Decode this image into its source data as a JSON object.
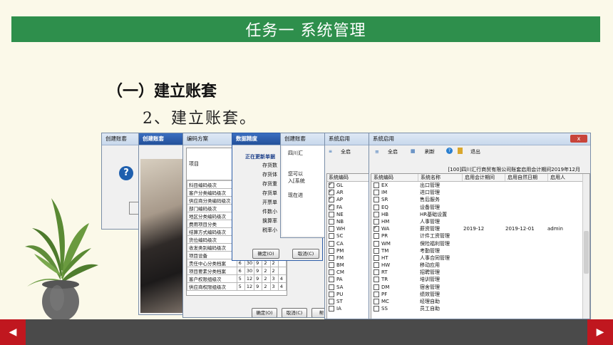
{
  "slide": {
    "title": "任务一 系统管理",
    "heading": "（一）建立账套",
    "subheading": "2、建立账套。"
  },
  "windows": {
    "create1_title": "创建账套",
    "create2_title": "创建账套",
    "code_scheme": {
      "title": "编码方案",
      "header": "项目",
      "rows": [
        {
          "label": "科目编码级次"
        },
        {
          "label": "客户分类编码级次"
        },
        {
          "label": "供应商分类编码级次"
        },
        {
          "label": "部门编码级次"
        },
        {
          "label": "地区分类编码级次"
        },
        {
          "label": "费用项目分类"
        },
        {
          "label": "结算方式编码级次"
        },
        {
          "label": "货位编码级次"
        },
        {
          "label": "收发类别编码级次"
        },
        {
          "label": "项目设备"
        },
        {
          "label": "责任中心分类档案",
          "v": [
            "6",
            "30",
            "9",
            "2",
            "2"
          ]
        },
        {
          "label": "项目要素分类档案",
          "v": [
            "6",
            "30",
            "9",
            "2",
            "2"
          ]
        },
        {
          "label": "客户权限组级次",
          "v": [
            "5",
            "12",
            "9",
            "2",
            "3",
            "4"
          ]
        },
        {
          "label": "供应商权限组级次",
          "v": [
            "5",
            "12",
            "9",
            "2",
            "3",
            "4"
          ]
        }
      ],
      "ok": "确定(O)",
      "cancel": "取消(C)",
      "help": "帮"
    },
    "progress": {
      "title": "数据精度",
      "status": "正在更新单据",
      "items": [
        "存货数",
        "存货体",
        "存货重",
        "存货单",
        "开票单",
        "件数小",
        "换算率",
        "税率小"
      ],
      "ok": "确定(O)",
      "cancel": "取消(C)"
    },
    "create3": {
      "title": "创建账套",
      "lines": [
        "四川汇",
        "您可以",
        "入[系统",
        "现在进"
      ]
    },
    "sys_enable1": {
      "title": "系统启用",
      "all": "全启",
      "col": "系统编码",
      "codes": [
        {
          "c": "GL",
          "on": true
        },
        {
          "c": "AR",
          "on": true
        },
        {
          "c": "AP",
          "on": true
        },
        {
          "c": "FA",
          "on": true
        },
        {
          "c": "NE",
          "on": false
        },
        {
          "c": "NB",
          "on": false
        },
        {
          "c": "WH",
          "on": false
        },
        {
          "c": "SC",
          "on": false
        },
        {
          "c": "CA",
          "on": false
        },
        {
          "c": "PM",
          "on": false
        },
        {
          "c": "FM",
          "on": false
        },
        {
          "c": "BM",
          "on": false
        },
        {
          "c": "CM",
          "on": false
        },
        {
          "c": "PA",
          "on": false
        },
        {
          "c": "SA",
          "on": false
        },
        {
          "c": "PU",
          "on": false
        },
        {
          "c": "ST",
          "on": false
        },
        {
          "c": "IA",
          "on": false
        }
      ]
    },
    "sys_enable2": {
      "title": "系统启用",
      "close": "x",
      "all": "全启",
      "refresh": "刷新",
      "exit": "退出",
      "banner": "[100]四川汇行商贸有限公司账套启用会计期间2019年12月",
      "headers": [
        "系统编码",
        "系统名称",
        "启用会计期间",
        "启用自然日期",
        "启用人"
      ],
      "rows": [
        {
          "c": "EX",
          "n": "出口管理",
          "on": false
        },
        {
          "c": "IM",
          "n": "进口管理",
          "on": false
        },
        {
          "c": "SR",
          "n": "售后服务",
          "on": false
        },
        {
          "c": "EQ",
          "n": "设备管理",
          "on": false
        },
        {
          "c": "HB",
          "n": "HR基础设置",
          "on": false
        },
        {
          "c": "HM",
          "n": "人事管理",
          "on": false
        },
        {
          "c": "WA",
          "n": "薪资管理",
          "on": true,
          "p": "2019-12",
          "d": "2019-12-01",
          "u": "admin"
        },
        {
          "c": "PR",
          "n": "计件工资管理",
          "on": false
        },
        {
          "c": "WM",
          "n": "保险福利管理",
          "on": false
        },
        {
          "c": "TM",
          "n": "考勤管理",
          "on": false
        },
        {
          "c": "HT",
          "n": "人事合同管理",
          "on": false
        },
        {
          "c": "HW",
          "n": "移动应用",
          "on": false
        },
        {
          "c": "RT",
          "n": "招聘管理",
          "on": false
        },
        {
          "c": "TR",
          "n": "培训管理",
          "on": false
        },
        {
          "c": "DM",
          "n": "宿舍管理",
          "on": false
        },
        {
          "c": "PF",
          "n": "绩效管理",
          "on": false
        },
        {
          "c": "MC",
          "n": "经理自助",
          "on": false
        },
        {
          "c": "SS",
          "n": "员工自助",
          "on": false
        }
      ]
    }
  },
  "nav": {
    "prev": "◀",
    "next": "▶"
  },
  "colors": {
    "banner": "#2e8f4c",
    "nav": "#c0171f",
    "bar": "#4a4a4a",
    "background": "#fbf9e9"
  }
}
